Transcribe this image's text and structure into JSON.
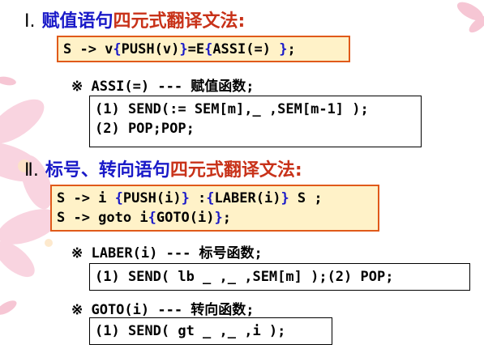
{
  "section1": {
    "number": "Ⅰ.",
    "title_blue": "赋值语句",
    "title_red": "四元式翻译文法:",
    "rule": [
      "S -> v",
      "{",
      "PUSH(v)",
      "}",
      "=E",
      "{",
      "ASSI(=) ",
      "}",
      ";"
    ],
    "note": "※ ASSI(=) --- 赋值函数;",
    "func_lines": [
      "(1) SEND(:= SEM[m],_ ,SEM[m-1] );",
      "(2) POP;POP;"
    ]
  },
  "section2": {
    "number": "Ⅱ.",
    "title_blue": "标号、转向语句",
    "title_red": "四元式翻译文法:",
    "rule1": [
      "S -> i ",
      "{",
      "PUSH(i)",
      "}",
      " :",
      "{",
      "LABER(i)",
      "}",
      " S ;"
    ],
    "rule2": [
      "S -> goto i",
      "{",
      "GOTO(i)",
      "}",
      ";"
    ],
    "note_laber": "※ LABER(i) --- 标号函数;",
    "laber_line": "(1) SEND( lb  _ ,_ ,SEM[m] );(2) POP;",
    "note_goto": "※ GOTO(i) --- 转向函数;",
    "goto_line": "(1) SEND( gt  _ ,_ ,i );"
  },
  "colors": {
    "blue": "#1a1ac8",
    "red": "#c83219",
    "orange_border": "#e05a1a",
    "box_fill": "#fff2c8",
    "decoration_pink": "#f7c6d6"
  }
}
